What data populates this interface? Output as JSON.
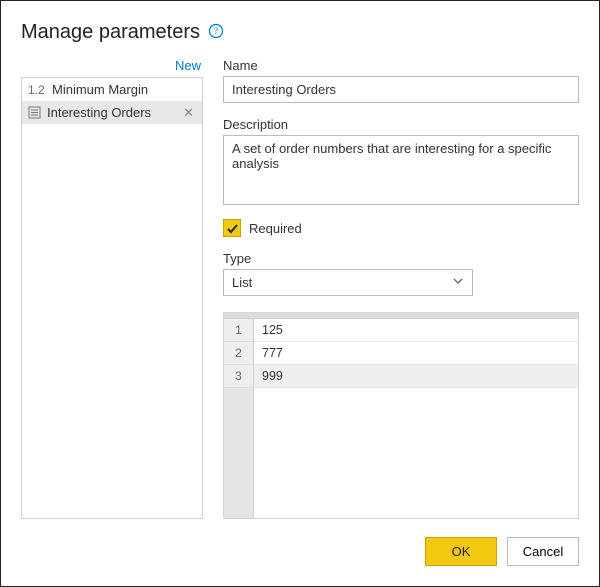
{
  "title": "Manage parameters",
  "new_link": "New",
  "sidebar": {
    "items": [
      {
        "kind": "1.2",
        "label": "Minimum Margin",
        "selected": false,
        "closable": false
      },
      {
        "kind": "list",
        "label": "Interesting Orders",
        "selected": true,
        "closable": true
      }
    ]
  },
  "form": {
    "name_label": "Name",
    "name_value": "Interesting Orders",
    "desc_label": "Description",
    "desc_value": "A set of order numbers that are interesting for a specific analysis",
    "required_label": "Required",
    "required_checked": true,
    "type_label": "Type",
    "type_value": "List",
    "list_values": [
      "125",
      "777",
      "999"
    ]
  },
  "buttons": {
    "ok": "OK",
    "cancel": "Cancel"
  }
}
